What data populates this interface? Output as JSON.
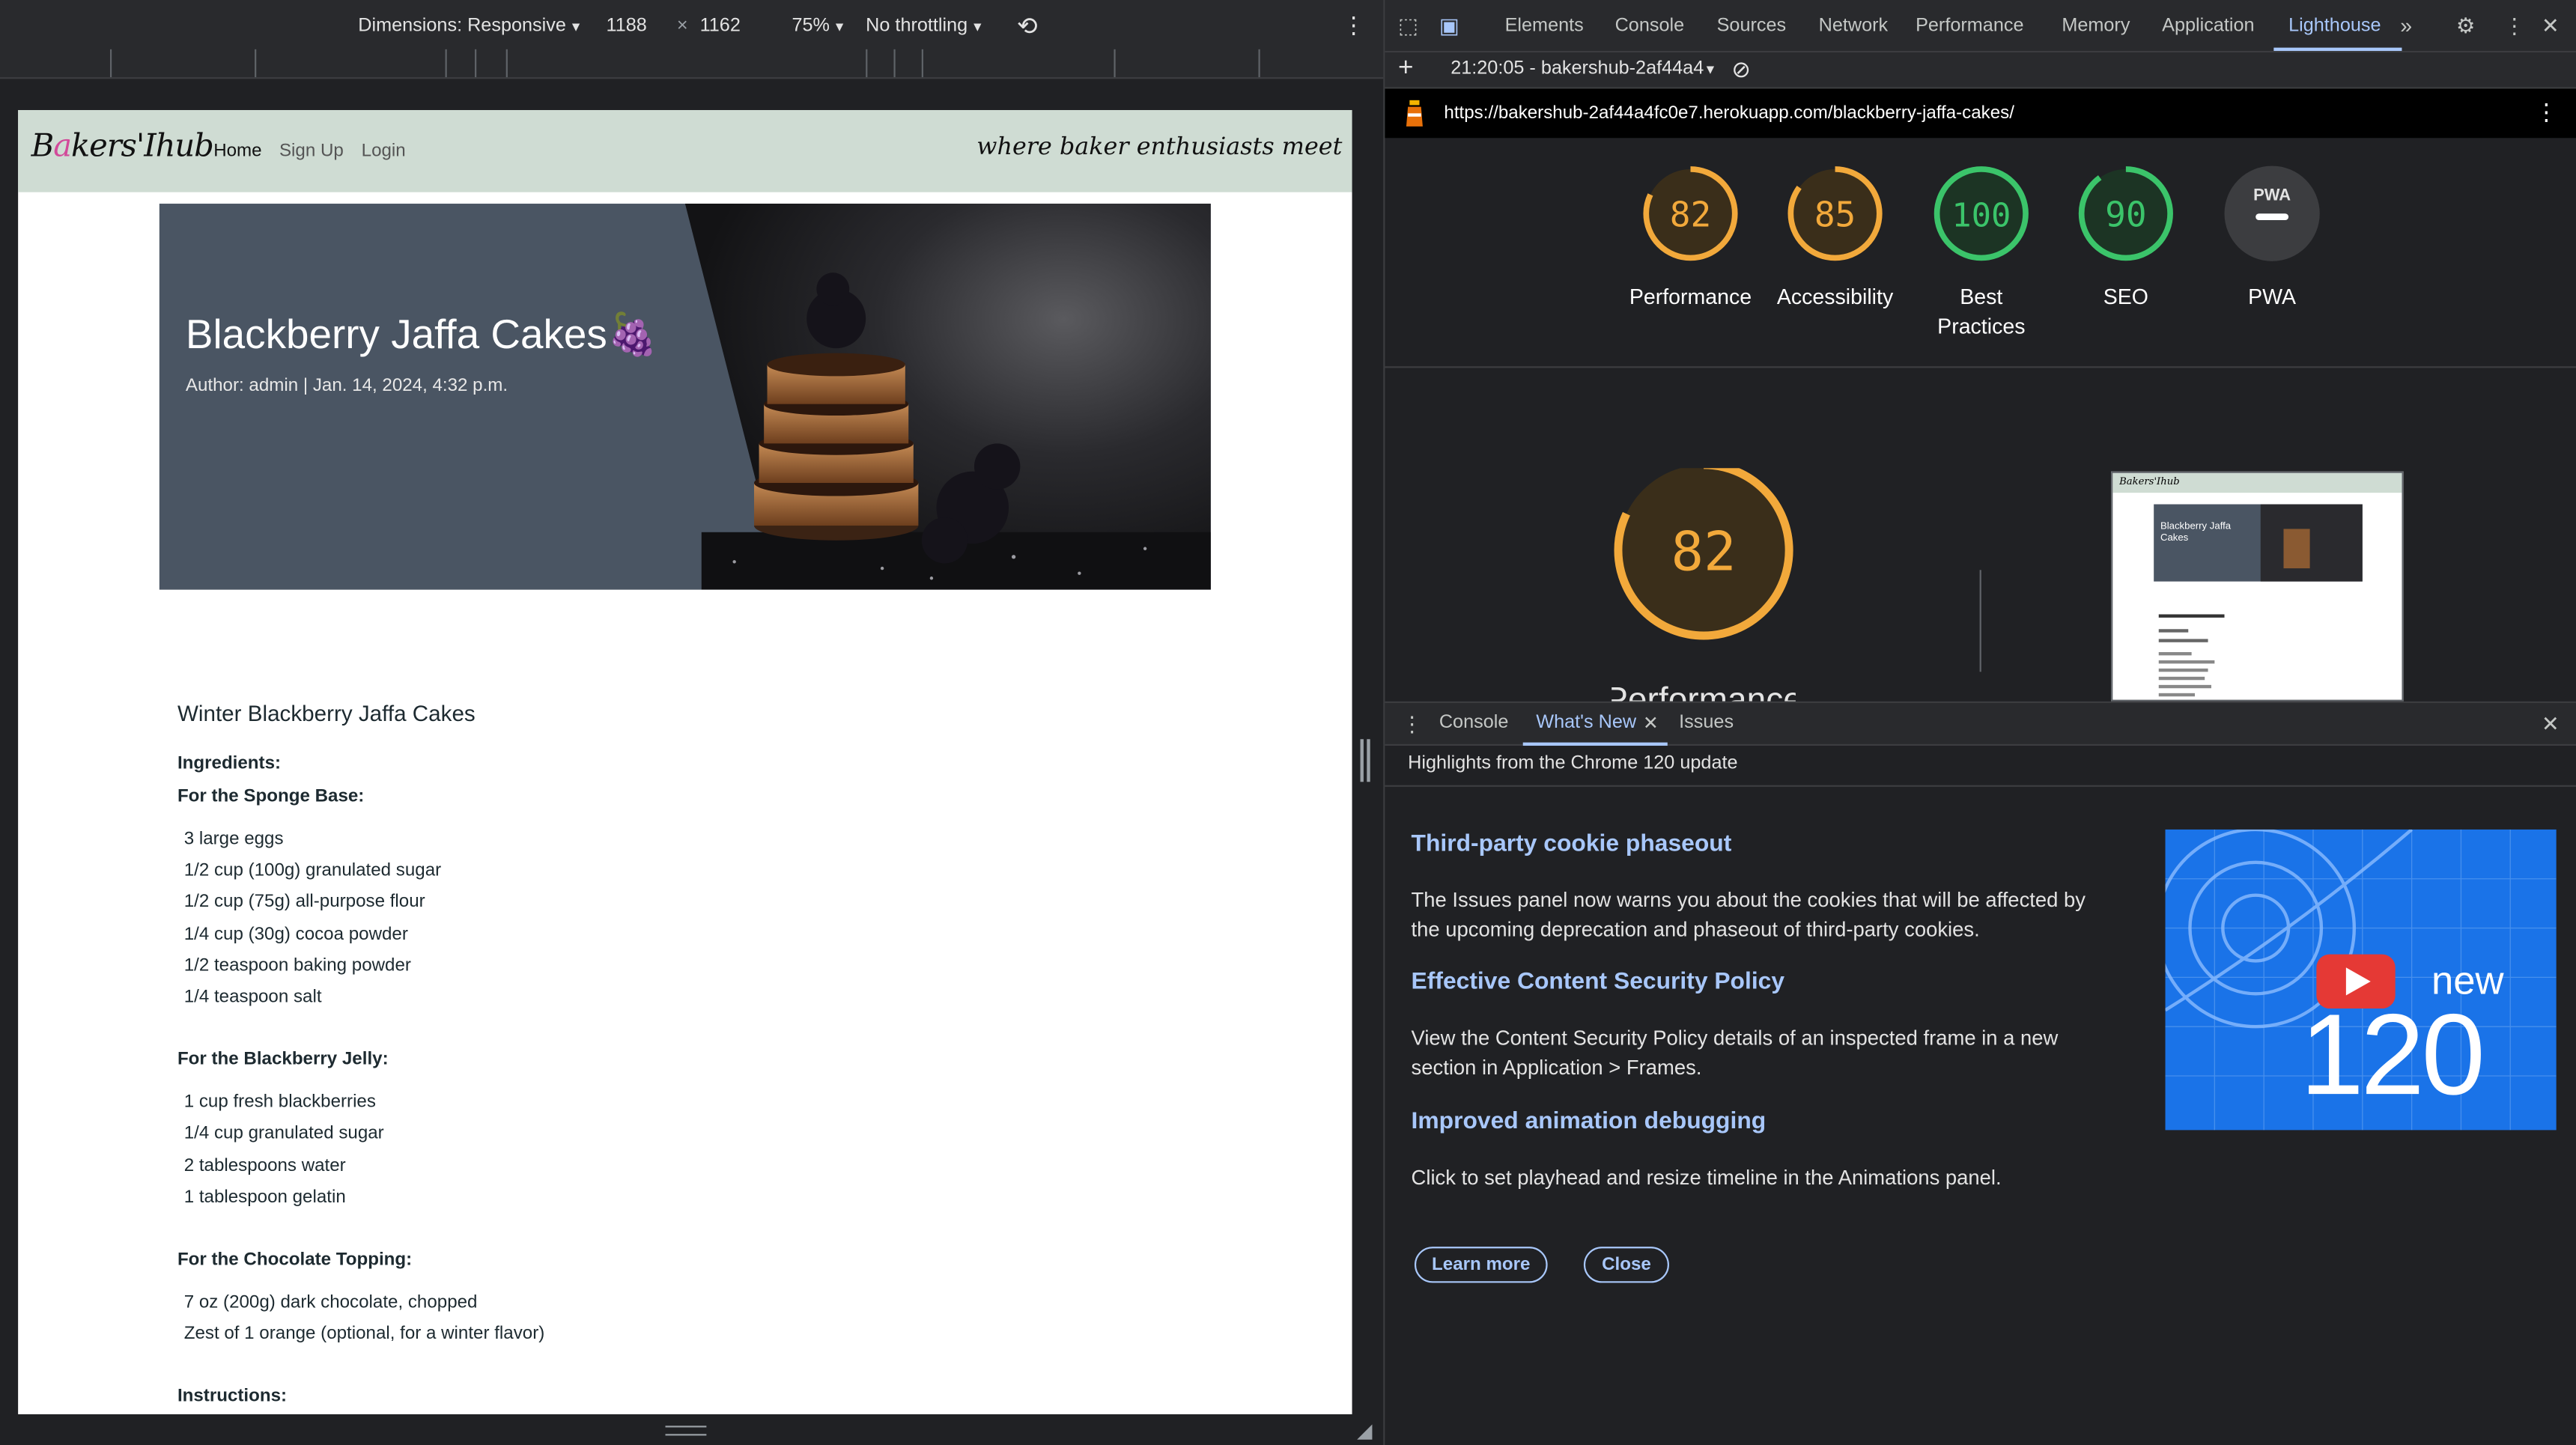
{
  "device_toolbar": {
    "dimensions_label": "Dimensions: Responsive",
    "width": "1188",
    "times": "×",
    "height": "1162",
    "zoom": "75%",
    "throttling": "No throttling"
  },
  "site": {
    "logo_pre": "B",
    "logo_mid": "a",
    "logo_post": "kers'Ihub",
    "nav": [
      "Home",
      "Sign Up",
      "Login"
    ],
    "tagline": "where baker enthusiasts meet",
    "hero_title": "Blackberry Jaffa Cakes🍇",
    "hero_meta": "Author: admin | Jan. 14, 2024, 4:32 p.m.",
    "recipe_title": "Winter Blackberry Jaffa Cakes",
    "ingredients_label": "Ingredients:",
    "sections": [
      {
        "title": "For the Sponge Base:",
        "items": [
          "3 large eggs",
          "1/2 cup (100g) granulated sugar",
          "1/2 cup (75g) all-purpose flour",
          "1/4 cup (30g) cocoa powder",
          "1/2 teaspoon baking powder",
          "1/4 teaspoon salt"
        ]
      },
      {
        "title": "For the Blackberry Jelly:",
        "items": [
          "1 cup fresh blackberries",
          "1/4 cup granulated sugar",
          "2 tablespoons water",
          "1 tablespoon gelatin"
        ]
      },
      {
        "title": "For the Chocolate Topping:",
        "items": [
          "7 oz (200g) dark chocolate, chopped",
          "Zest of 1 orange (optional, for a winter flavor)"
        ]
      }
    ],
    "instructions_label": "Instructions:"
  },
  "devtools": {
    "tabs": [
      "Elements",
      "Console",
      "Sources",
      "Network",
      "Performance",
      "Memory",
      "Application",
      "Lighthouse"
    ],
    "active_tab": "Lighthouse",
    "report_label": "21:20:05 - bakershub-2af44a4",
    "url": "https://bakershub-2af44a4fc0e7.herokuapp.com/blackberry-jaffa-cakes/",
    "scores": [
      {
        "label": "Performance",
        "value": 82,
        "color": "#f2a93b"
      },
      {
        "label": "Accessibility",
        "value": 85,
        "color": "#f2a93b"
      },
      {
        "label": "Best Practices",
        "value": 100,
        "color": "#3bc46a"
      },
      {
        "label": "SEO",
        "value": 90,
        "color": "#3bc46a"
      },
      {
        "label": "PWA",
        "value": null,
        "color": "#9aa0a6"
      }
    ],
    "pwa_badge": "PWA",
    "big_score": "82",
    "big_label": "Performance",
    "thumb_title": "Blackberry Jaffa Cakes",
    "thumb_logo": "Bakers'Ihub",
    "drawer_tabs": [
      "Console",
      "What's New",
      "Issues"
    ],
    "highlights": "Highlights from the Chrome 120 update",
    "features": [
      {
        "title": "Third-party cookie phaseout",
        "desc": "The Issues panel now warns you about the cookies that will be affected by the upcoming deprecation and phaseout of third-party cookies."
      },
      {
        "title": "Effective Content Security Policy",
        "desc": "View the Content Security Policy details of an inspected frame in a new section in Application > Frames."
      },
      {
        "title": "Improved animation debugging",
        "desc": "Click to set playhead and resize timeline in the Animations panel."
      }
    ],
    "learn_more": "Learn more",
    "close": "Close",
    "promo_new": "new",
    "promo_version": "120"
  }
}
